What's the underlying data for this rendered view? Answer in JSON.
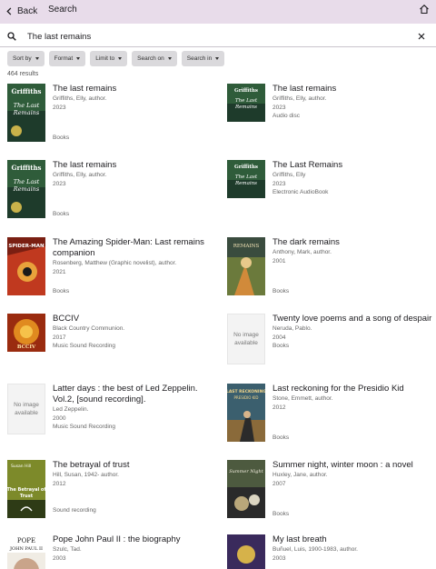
{
  "header": {
    "back_label": "Back",
    "title": "Search"
  },
  "search": {
    "query": "The last remains"
  },
  "filters": [
    "Sort by",
    "Format",
    "Limit to",
    "Search on",
    "Search in"
  ],
  "results_count": "464 results",
  "results": [
    {
      "title": "The last remains",
      "author": "Griffiths, Elly, author.",
      "year": "2023",
      "format": "Books",
      "cover_text": "Elly Griffiths The Last Remains",
      "has_image": true
    },
    {
      "title": "The last remains",
      "author": "Griffiths, Elly, author.",
      "year": "2023",
      "format": "Audio disc",
      "cover_text": "Griffiths The Last Remains",
      "has_image": true
    },
    {
      "title": "The last remains",
      "author": "Griffiths, Elly, author.",
      "year": "2023",
      "format": "Books",
      "cover_text": "Elly Griffiths The Last Remains",
      "has_image": true
    },
    {
      "title": "The Last Remains",
      "author": "Griffiths, Elly",
      "year": "2023",
      "format": "Electronic AudioBook",
      "cover_text": "Griffiths The Last Remains",
      "has_image": true
    },
    {
      "title": "The Amazing Spider-Man: Last remains companion",
      "author": "Rosenberg, Matthew (Graphic novelist), author.",
      "year": "2021",
      "format": "Books",
      "cover_text": "Spider-Man",
      "has_image": true
    },
    {
      "title": "The dark remains",
      "author": "Anthony, Mark, author.",
      "year": "2001",
      "format": "Books",
      "cover_text": "Dark Remains",
      "has_image": true
    },
    {
      "title": "BCCIV",
      "author": "Black Country Communion.",
      "year": "2017",
      "format": "Music Sound Recording",
      "cover_text": "BCCIV",
      "has_image": true
    },
    {
      "title": "Twenty love poems and a song of despair",
      "author": "Neruda, Pablo.",
      "year": "2004",
      "format": "Books",
      "cover_text": "No image available",
      "has_image": false
    },
    {
      "title": "Latter days : the best of Led Zeppelin. Vol.2, [sound recording].",
      "author": "Led Zeppelin.",
      "year": "2000",
      "format": "Music Sound Recording",
      "cover_text": "No image available",
      "has_image": false
    },
    {
      "title": "Last reckoning for the Presidio Kid",
      "author": "Stone, Emmett, author.",
      "year": "2012",
      "format": "Books",
      "cover_text": "Last Reckoning for the Presidio Kid",
      "has_image": true
    },
    {
      "title": "The betrayal of trust",
      "author": "Hill, Susan, 1942- author.",
      "year": "2012",
      "format": "Sound recording",
      "cover_text": "Susan Hill The Betrayal of Trust",
      "has_image": true
    },
    {
      "title": "Summer night, winter moon : a novel",
      "author": "Huxley, Jane, author.",
      "year": "2007",
      "format": "Books",
      "cover_text": "Summer Night",
      "has_image": true
    },
    {
      "title": "Pope John Paul II : the biography",
      "author": "Szulc, Tad.",
      "year": "2003",
      "format": "",
      "cover_text": "POPE JOHN PAUL II",
      "has_image": true
    },
    {
      "title": "My last breath",
      "author": "Buñuel, Luis, 1900-1983, author.",
      "year": "2003",
      "format": "",
      "cover_text": "My Last Breath",
      "has_image": true
    }
  ]
}
